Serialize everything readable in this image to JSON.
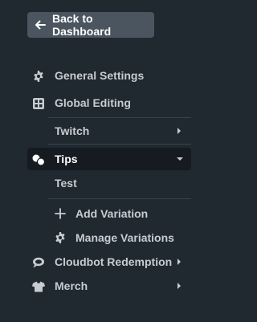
{
  "back_button": {
    "label": "Back to Dashboard",
    "icon": "arrow-left-icon"
  },
  "menu": {
    "general_settings": {
      "label": "General Settings",
      "icon": "gear-icon"
    },
    "global_editing": {
      "label": "Global Editing",
      "icon": "grid-icon"
    },
    "twitch": {
      "label": "Twitch"
    },
    "tips": {
      "label": "Tips",
      "icon": "coins-icon",
      "expanded": true
    },
    "tips_sub": {
      "test": {
        "label": "Test"
      },
      "add_variation": {
        "label": "Add Variation",
        "icon": "plus-icon"
      },
      "manage_variations": {
        "label": "Manage Variations",
        "icon": "gear-icon"
      }
    },
    "cloudbot_redemption": {
      "label": "Cloudbot Redemption",
      "icon": "speech-bubble-icon"
    },
    "merch": {
      "label": "Merch",
      "icon": "tshirt-icon"
    }
  },
  "colors": {
    "background": "#202830",
    "button_bg": "#4a5560",
    "active_bg": "#151b20",
    "text": "#c7ccd1",
    "divider": "#3a434c"
  }
}
